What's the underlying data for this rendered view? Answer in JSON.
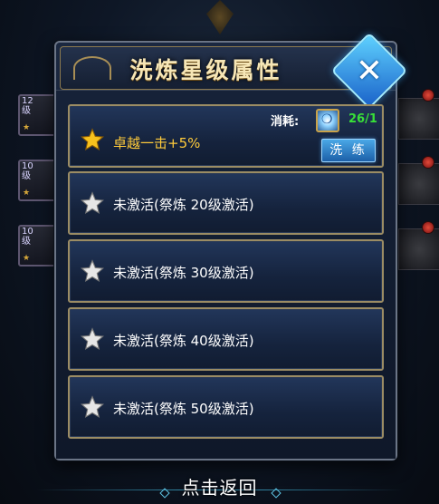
{
  "dialog": {
    "title": "洗炼星级属性"
  },
  "active_attribute": {
    "text": "卓越一击+5%",
    "cost_label": "消耗:",
    "cost_count": "26/1",
    "refine_button": "洗 练"
  },
  "locked_attributes": [
    {
      "text": "未激活(祭炼  20级激活)"
    },
    {
      "text": "未激活(祭炼  30级激活)"
    },
    {
      "text": "未激活(祭炼  40级激活)"
    },
    {
      "text": "未激活(祭炼  50级激活)"
    }
  ],
  "background": {
    "slots": [
      {
        "level": "12",
        "unit": "级"
      },
      {
        "level": "10",
        "unit": "级"
      },
      {
        "level": "10",
        "unit": "级"
      }
    ]
  },
  "footer": {
    "return_label": "点击返回"
  },
  "colors": {
    "active_text": "#ffcb3b",
    "cost_count": "#38e038",
    "star_gold": "#f7c11d",
    "star_silver": "#e6e6e6",
    "accent_blue": "#1a62c9"
  },
  "icons": {
    "close": "close-x-icon",
    "active_star": "gold-star-icon",
    "locked_star": "silver-star-icon",
    "cost_item": "refine-stone-icon"
  }
}
